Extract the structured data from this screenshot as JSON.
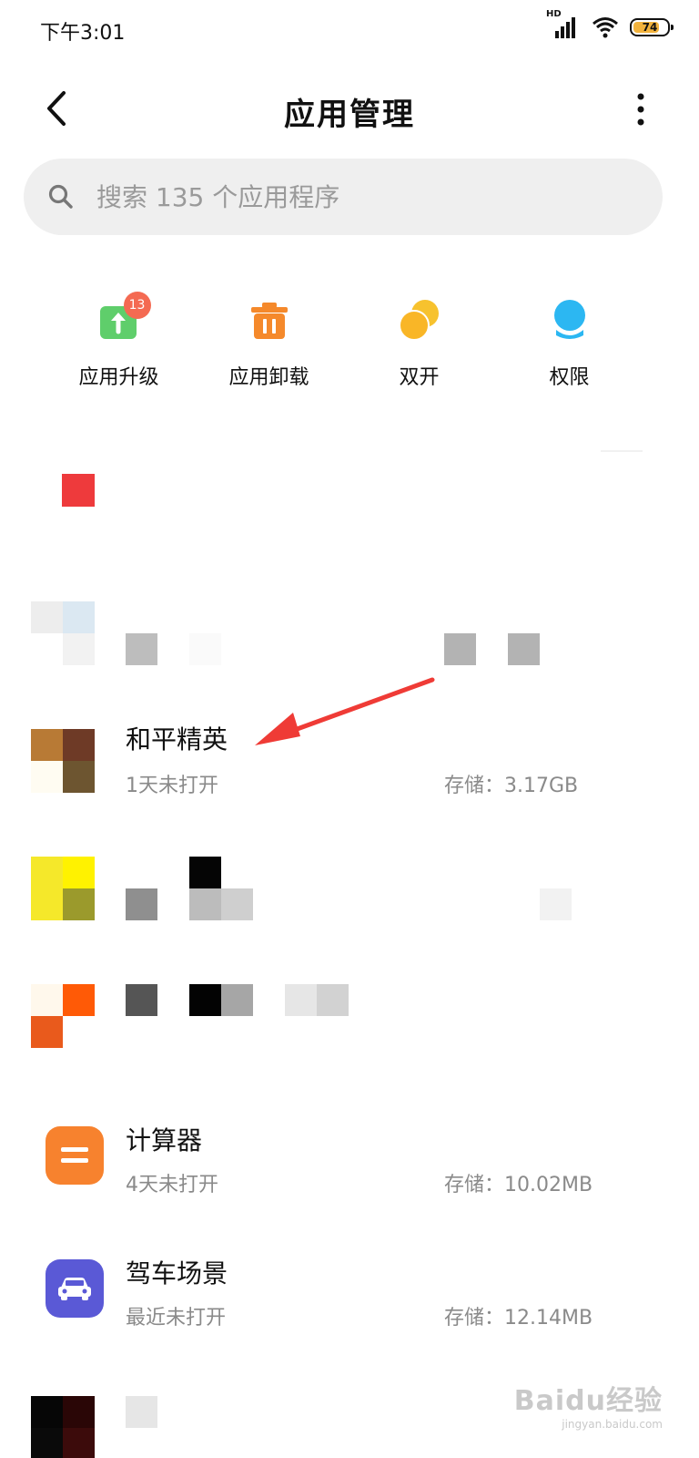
{
  "status_bar": {
    "time": "下午3:01",
    "network_label": "HD",
    "battery": "74",
    "battery_color": "#f2b33d"
  },
  "header": {
    "title": "应用管理",
    "back_icon": "chevron-left-icon",
    "more_icon": "more-vertical-icon"
  },
  "search": {
    "placeholder": "搜索 135 个应用程序"
  },
  "quick_actions": [
    {
      "label": "应用升级",
      "icon": "upgrade-icon",
      "badge": "13",
      "color": "#5fce6b"
    },
    {
      "label": "应用卸载",
      "icon": "trash-icon",
      "color": "#f5892b"
    },
    {
      "label": "双开",
      "icon": "dual-app-icon",
      "color": "#f7c22e"
    },
    {
      "label": "权限",
      "icon": "permission-icon",
      "color": "#2cb7f2"
    }
  ],
  "apps": [
    {
      "name": "和平精英",
      "last_open": "1天未打开",
      "storage": "存储：3.17GB"
    },
    {
      "name": "计算器",
      "last_open": "4天未打开",
      "storage": "存储：10.02MB",
      "icon_color": "#f7822e"
    },
    {
      "name": "驾车场景",
      "last_open": "最近未打开",
      "storage": "存储：12.14MB",
      "icon_color": "#5a59d6"
    }
  ],
  "watermark": {
    "text": "Baidu经验",
    "sub": "jingyan.baidu.com"
  }
}
